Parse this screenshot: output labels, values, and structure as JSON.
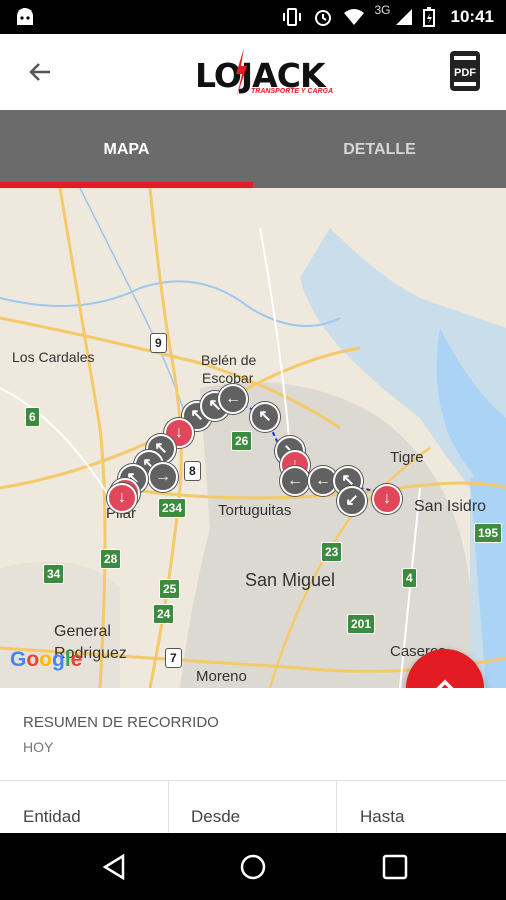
{
  "status_bar": {
    "network": "3G",
    "time": "10:41",
    "icons": [
      "android-icon",
      "vibrate-icon",
      "alarm-icon",
      "wifi-icon",
      "signal-icon",
      "battery-icon"
    ]
  },
  "app_bar": {
    "logo_text": "LOJACK",
    "logo_tagline": "TRANSPORTE Y CARGA",
    "pdf_label": "PDF"
  },
  "tabs": [
    {
      "label": "MAPA",
      "active": true
    },
    {
      "label": "DETALLE",
      "active": false
    }
  ],
  "map": {
    "places": [
      {
        "name": "Los Cardales"
      },
      {
        "name": "Belén de"
      },
      {
        "name": "Escobar"
      },
      {
        "name": "Tigre"
      },
      {
        "name": "San Isidro"
      },
      {
        "name": "Pilar"
      },
      {
        "name": "Tortuguitas"
      },
      {
        "name": "San Miguel"
      },
      {
        "name": "General"
      },
      {
        "name": "Rodriguez"
      },
      {
        "name": "Moreno"
      },
      {
        "name": "Caseros"
      }
    ],
    "route_numbers": [
      "9",
      "6",
      "26",
      "8",
      "234",
      "23",
      "195",
      "28",
      "34",
      "25",
      "24",
      "4",
      "201",
      "7"
    ],
    "attribution": "Google"
  },
  "summary": {
    "title": "RESUMEN DE RECORRIDO",
    "period": "HOY"
  },
  "table_headers": [
    "Entidad",
    "Desde",
    "Hasta"
  ],
  "colors": {
    "accent": "#e31b23",
    "tab_bar": "#6b6b6b",
    "marker_grey": "#616161",
    "marker_red": "#e0475a"
  }
}
